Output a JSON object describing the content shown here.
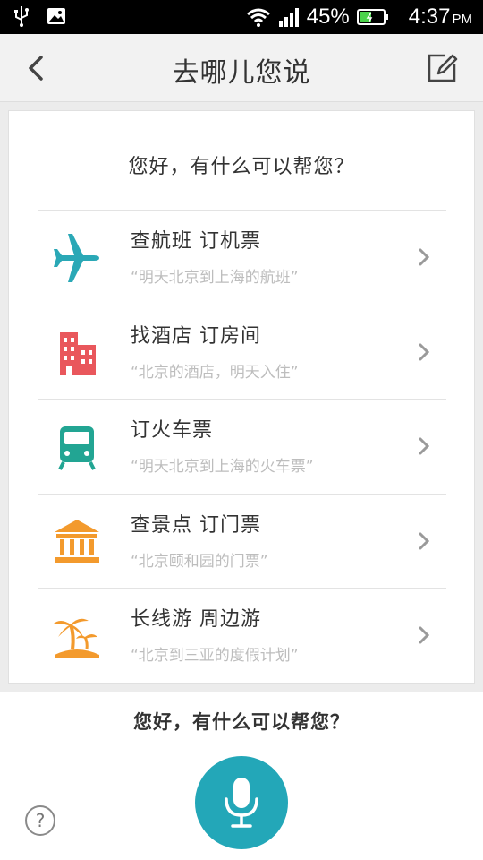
{
  "status_bar": {
    "battery_percent": "45%",
    "time": "4:37",
    "ampm": "PM",
    "icons": [
      "usb-icon",
      "image-icon",
      "wifi-icon",
      "signal-icon",
      "battery-icon"
    ]
  },
  "header": {
    "title": "去哪儿您说",
    "back_icon": "chevron-left-icon",
    "edit_icon": "edit-icon"
  },
  "card": {
    "greeting": "您好，有什么可以帮您？",
    "items": [
      {
        "title": "查航班 订机票",
        "hint": "“明天北京到上海的航班”",
        "icon": "airplane-icon",
        "color": "#2aa8b6"
      },
      {
        "title": "找酒店 订房间",
        "hint": "“北京的酒店，明天入住”",
        "icon": "hotel-icon",
        "color": "#e9575c"
      },
      {
        "title": "订火车票",
        "hint": "“明天北京到上海的火车票”",
        "icon": "train-icon",
        "color": "#22a593"
      },
      {
        "title": "查景点 订门票",
        "hint": "“北京颐和园的门票”",
        "icon": "temple-icon",
        "color": "#f39a2d"
      },
      {
        "title": "长线游 周边游",
        "hint": "“北京到三亚的度假计划”",
        "icon": "palm-tree-icon",
        "color": "#f39a2d"
      }
    ]
  },
  "bottom": {
    "prompt": "您好，有什么可以帮您？",
    "help_label": "?",
    "mic_color": "#23a7b8"
  }
}
